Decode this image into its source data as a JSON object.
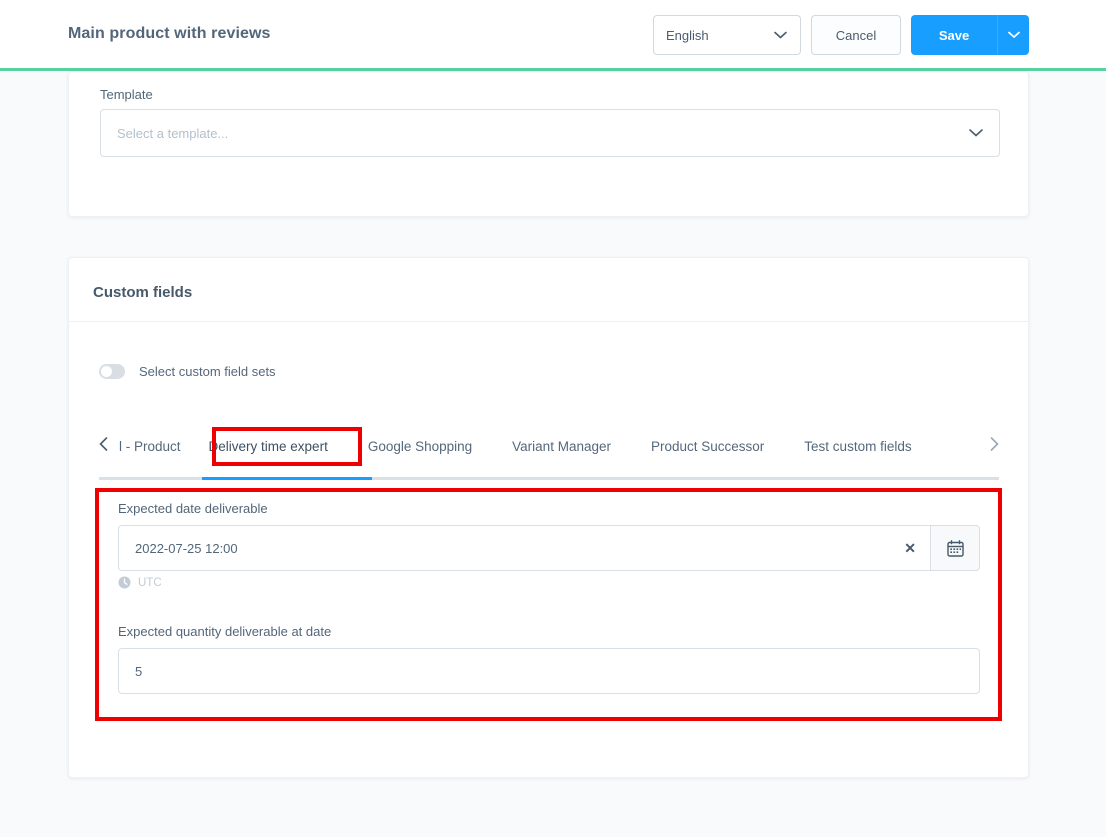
{
  "header": {
    "title": "Main product with reviews",
    "language_select": {
      "value": "English",
      "icon": "chevron-down-icon"
    },
    "cancel_label": "Cancel",
    "save_label": "Save",
    "save_dropdown_icon": "chevron-down-icon",
    "accent_color": "#189eff",
    "progress_color": "#56d2a0"
  },
  "template_card": {
    "label": "Template",
    "select_placeholder": "Select a template...",
    "select_icon": "chevron-down-icon"
  },
  "custom_fields_card": {
    "title": "Custom fields",
    "toggle": {
      "label": "Select custom field sets",
      "state": "off"
    },
    "tabs": {
      "prev_icon": "chevron-left-icon",
      "next_icon": "chevron-right-icon",
      "items": [
        {
          "label": "l - Product",
          "active": false,
          "partial": true
        },
        {
          "label": "Delivery time expert",
          "active": true,
          "partial": false
        },
        {
          "label": "Google Shopping",
          "active": false,
          "partial": false
        },
        {
          "label": "Variant Manager",
          "active": false,
          "partial": false
        },
        {
          "label": "Product Successor",
          "active": false,
          "partial": false
        },
        {
          "label": "Test custom fields",
          "active": false,
          "partial": false
        }
      ],
      "active_underline_color": "#189eff"
    },
    "panel": {
      "date_field": {
        "label": "Expected date deliverable",
        "value": "2022-07-25 12:00",
        "clear_icon": "close-icon",
        "calendar_icon": "calendar-icon",
        "timezone_icon": "clock-icon",
        "timezone": "UTC"
      },
      "quantity_field": {
        "label": "Expected quantity deliverable at date",
        "value": "5"
      }
    }
  },
  "annotations": {
    "color": "#ee0000",
    "boxes": [
      {
        "name": "active-tab-highlight"
      },
      {
        "name": "custom-field-panel-highlight"
      }
    ]
  }
}
